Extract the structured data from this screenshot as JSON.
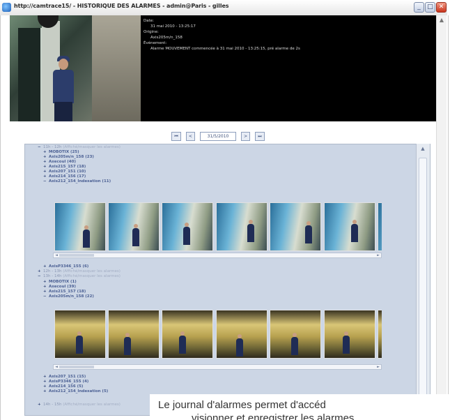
{
  "window": {
    "title": "http://camtrace15/ - HISTORIQUE DES ALARMES - admin@Paris - gilles",
    "min_glyph": "_",
    "max_glyph": "□",
    "close_glyph": "✕"
  },
  "alarm_detail": {
    "date_label": "Date:",
    "date_value": "31 mai 2010 - 13:25:17",
    "origin_label": "Origine:",
    "origin_value": "Axis205m/n_158",
    "event_label": "Événement:",
    "event_value": "Alarme MOUVEMENT commencée à 31 mai 2010 - 13:25:15, pré alarme de 2s"
  },
  "navigation": {
    "first": "⏮",
    "prev": "<",
    "date": "31/5/2010",
    "next": ">",
    "last": "⏭"
  },
  "tree": {
    "group1": {
      "sign": "−",
      "label": "11h - 12h",
      "note": "(Affiché/masquer les alarmes)"
    },
    "group1_items": [
      {
        "sign": "+",
        "label": "MOBOTIX (25)"
      },
      {
        "sign": "+",
        "label": "Axis205m/n_158 (23)"
      },
      {
        "sign": "+",
        "label": "Axecoul (40)"
      },
      {
        "sign": "+",
        "label": "Axis215_157 (18)"
      },
      {
        "sign": "+",
        "label": "Axis207_151 (10)"
      },
      {
        "sign": "+",
        "label": "Axis214_156 (17)"
      },
      {
        "sign": "−",
        "label": "Axis212_154_Indexation (11)"
      }
    ],
    "group1_after": {
      "sign": "+",
      "label": "AxisP3346_155 (6)"
    },
    "group2": {
      "sign": "+",
      "label": "12h - 13h",
      "note": "(Affiché/masquer les alarmes)"
    },
    "group3": {
      "sign": "−",
      "label": "13h - 14h",
      "note": "(Affiché/masquer les alarmes)"
    },
    "group3_items": [
      {
        "sign": "+",
        "label": "MOBOTIX (1)"
      },
      {
        "sign": "+",
        "label": "Axecoul (39)"
      },
      {
        "sign": "+",
        "label": "Axis215_157 (18)"
      },
      {
        "sign": "−",
        "label": "Axis205m/n_158 (22)"
      }
    ],
    "group3_after": [
      {
        "sign": "+",
        "label": "Axis207_151 (15)"
      },
      {
        "sign": "+",
        "label": "AxisP3346_155 (4)"
      },
      {
        "sign": "+",
        "label": "Axis214_156 (5)"
      },
      {
        "sign": "+",
        "label": "Axis212_154_Indexation (5)"
      }
    ],
    "group4": {
      "sign": "+",
      "label": "14h - 15h",
      "note": "(Affiché/masquer les alarmes)"
    }
  },
  "scroll": {
    "up": "▲",
    "left": "◄",
    "right": "►"
  },
  "caption": {
    "line1": "Le journal d'alarmes permet d'accéd",
    "line2": "visionner et enregistrer les alarmes"
  }
}
